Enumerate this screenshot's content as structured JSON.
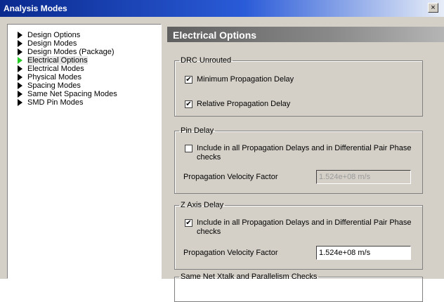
{
  "window": {
    "title": "Analysis Modes",
    "close_label": "×"
  },
  "tree": {
    "items": [
      {
        "label": "Design Options",
        "active": false
      },
      {
        "label": "Design Modes",
        "active": false
      },
      {
        "label": "Design Modes (Package)",
        "active": false
      },
      {
        "label": "Electrical Options",
        "active": true
      },
      {
        "label": "Electrical Modes",
        "active": false
      },
      {
        "label": "Physical Modes",
        "active": false
      },
      {
        "label": "Spacing Modes",
        "active": false
      },
      {
        "label": "Same Net Spacing Modes",
        "active": false
      },
      {
        "label": "SMD Pin Modes",
        "active": false
      }
    ]
  },
  "panel": {
    "title": "Electrical Options",
    "drc_unrouted": {
      "legend": "DRC Unrouted",
      "min_prop_delay": {
        "label": "Minimum Propagation Delay",
        "checked": true
      },
      "rel_prop_delay": {
        "label": "Relative Propagation Delay",
        "checked": true
      }
    },
    "pin_delay": {
      "legend": "Pin Delay",
      "include": {
        "label": "Include in all Propagation Delays and in Differential Pair Phase checks",
        "checked": false
      },
      "velocity_label": "Propagation Velocity Factor",
      "velocity_value": "1.524e+08 m/s"
    },
    "z_axis_delay": {
      "legend": "Z Axis Delay",
      "include": {
        "label": "Include in all Propagation Delays and in Differential Pair Phase checks",
        "checked": true
      },
      "velocity_label": "Propagation Velocity Factor",
      "velocity_value": "1.524e+08 m/s"
    },
    "same_net": {
      "legend": "Same Net Xtalk and Parallelism Checks"
    }
  },
  "colors": {
    "titlebar_start": "#0a2a8e",
    "active_arrow": "#22cc22",
    "dialog_bg": "#d4d0c8"
  },
  "icons": {
    "tree_arrow": "triangle-right-icon",
    "check": "checkmark-icon"
  }
}
